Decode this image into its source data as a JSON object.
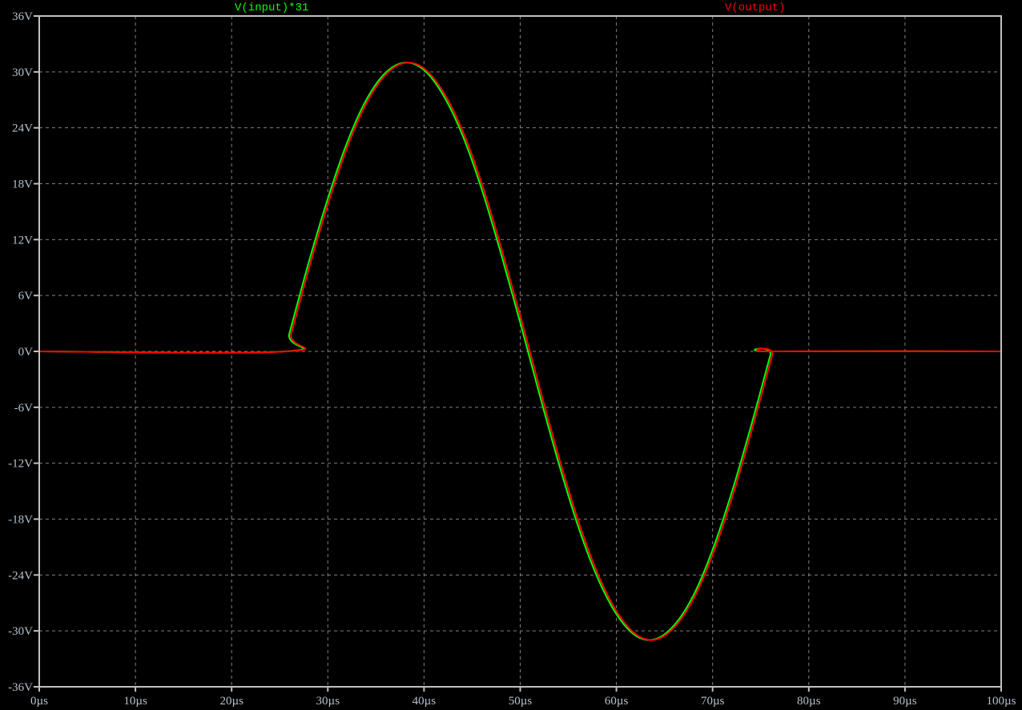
{
  "chart_data": {
    "type": "line",
    "title": "",
    "xlabel": "",
    "ylabel": "",
    "xlim": [
      0,
      100
    ],
    "ylim": [
      -36,
      36
    ],
    "grid": true,
    "x_unit": "µs",
    "y_unit": "V",
    "x_ticks": [
      "0µs",
      "10µs",
      "20µs",
      "30µs",
      "40µs",
      "50µs",
      "60µs",
      "70µs",
      "80µs",
      "90µs",
      "100µs"
    ],
    "x_tick_values": [
      0,
      10,
      20,
      30,
      40,
      50,
      60,
      70,
      80,
      90,
      100
    ],
    "y_ticks": [
      "36V",
      "30V",
      "24V",
      "18V",
      "12V",
      "6V",
      "0V",
      "-6V",
      "-12V",
      "-18V",
      "-24V",
      "-30V",
      "-36V"
    ],
    "y_tick_values": [
      36,
      30,
      24,
      18,
      12,
      6,
      0,
      -6,
      -12,
      -18,
      -24,
      -30,
      -36
    ],
    "x": [
      0,
      25.5,
      26,
      28,
      30,
      32,
      34,
      36,
      38,
      40,
      42,
      44,
      46,
      48,
      50,
      52,
      54,
      56,
      58,
      60,
      62,
      64,
      66,
      68,
      70,
      72,
      74,
      76,
      76.1,
      100
    ],
    "series": [
      {
        "name": "V(input)*31",
        "color": "#00ff00",
        "x_shift": 0,
        "values": [
          0,
          0,
          1.9,
          9.5,
          16.4,
          22.4,
          27.0,
          29.9,
          31.0,
          30.2,
          27.5,
          23.2,
          17.4,
          10.5,
          3.1,
          -4.6,
          -12.0,
          -18.7,
          -24.2,
          -28.2,
          -30.5,
          -30.9,
          -29.4,
          -26.2,
          -21.3,
          -15.1,
          -8.0,
          -0.4,
          0,
          0
        ]
      },
      {
        "name": "V(output)",
        "color": "#ff0000",
        "x_shift": 0.2,
        "values": [
          0,
          0,
          1.9,
          9.5,
          16.4,
          22.4,
          27.0,
          29.9,
          31.0,
          30.2,
          27.5,
          23.2,
          17.4,
          10.5,
          3.1,
          -4.6,
          -12.0,
          -18.7,
          -24.2,
          -28.2,
          -30.5,
          -30.9,
          -29.4,
          -26.2,
          -21.3,
          -15.1,
          -8.0,
          -0.4,
          0,
          0
        ]
      }
    ],
    "colors": {
      "background": "#000000",
      "axis": "#c0c0c0",
      "grid": "#808080",
      "tick_text": "#b4c0cc"
    }
  }
}
